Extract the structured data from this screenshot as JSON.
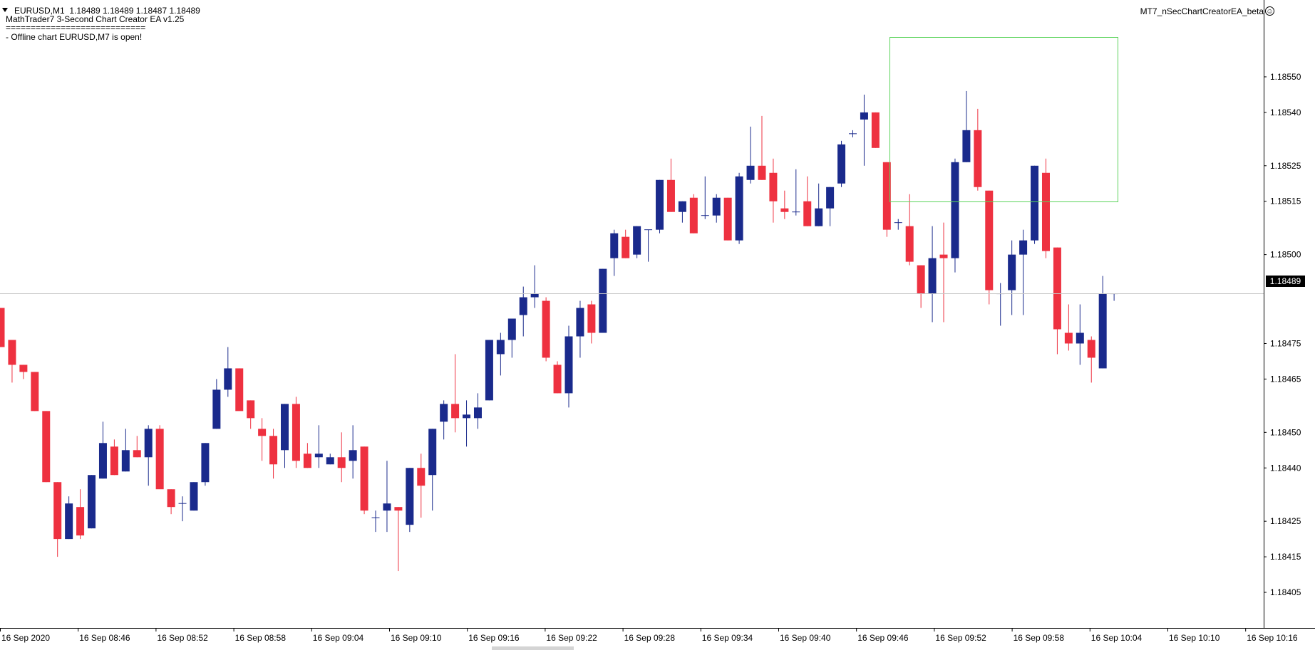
{
  "window": {
    "symbol_line": "EURUSD,M1  1.18489 1.18489 1.18487 1.18489",
    "ea_title_line": "MathTrader7 3-Second Chart Creator EA v1.25",
    "separator_line": "============================",
    "status_line": "- Offline chart EURUSD,M7 is open!",
    "ea_name": "MT7_nSecChartCreatorEA_beta",
    "smiley_icon": "smiley-icon",
    "collapse_icon": "triangle-down-icon"
  },
  "chart_data": {
    "type": "candlestick",
    "symbol": "EURUSD",
    "timeframe": "M1",
    "y_range": [
      1.184,
      1.1856
    ],
    "y_ticks": [
      "1.18550",
      "1.18540",
      "1.18525",
      "1.18515",
      "1.18500",
      "1.18475",
      "1.18465",
      "1.18450",
      "1.18440",
      "1.18425",
      "1.18415",
      "1.18405"
    ],
    "x_ticks": [
      "16 Sep 2020",
      "16 Sep 08:46",
      "16 Sep 08:52",
      "16 Sep 08:58",
      "16 Sep 09:04",
      "16 Sep 09:10",
      "16 Sep 09:16",
      "16 Sep 09:22",
      "16 Sep 09:28",
      "16 Sep 09:34",
      "16 Sep 09:40",
      "16 Sep 09:46",
      "16 Sep 09:52",
      "16 Sep 09:58",
      "16 Sep 10:04",
      "16 Sep 10:10",
      "16 Sep 10:16"
    ],
    "current_price": "1.18489",
    "colors": {
      "bull": "#1a2a8c",
      "bear": "#ee3140",
      "grid_line": "#c8c8c8",
      "selection_box": "#5bd35b"
    },
    "grid": false,
    "candles": [
      {
        "o": 1.18485,
        "h": 1.18485,
        "l": 1.18474,
        "c": 1.18474
      },
      {
        "o": 1.18476,
        "h": 1.18476,
        "l": 1.18464,
        "c": 1.18469
      },
      {
        "o": 1.18469,
        "h": 1.18469,
        "l": 1.18465,
        "c": 1.18467
      },
      {
        "o": 1.18467,
        "h": 1.18467,
        "l": 1.18456,
        "c": 1.18456
      },
      {
        "o": 1.18456,
        "h": 1.18456,
        "l": 1.18436,
        "c": 1.18436
      },
      {
        "o": 1.18436,
        "h": 1.18436,
        "l": 1.18415,
        "c": 1.1842
      },
      {
        "o": 1.1842,
        "h": 1.18432,
        "l": 1.1842,
        "c": 1.1843
      },
      {
        "o": 1.18429,
        "h": 1.18434,
        "l": 1.1842,
        "c": 1.18421
      },
      {
        "o": 1.18423,
        "h": 1.18438,
        "l": 1.18423,
        "c": 1.18438
      },
      {
        "o": 1.18437,
        "h": 1.18453,
        "l": 1.18437,
        "c": 1.18447
      },
      {
        "o": 1.18446,
        "h": 1.18448,
        "l": 1.18438,
        "c": 1.18438
      },
      {
        "o": 1.18439,
        "h": 1.18451,
        "l": 1.18439,
        "c": 1.18445
      },
      {
        "o": 1.18445,
        "h": 1.18449,
        "l": 1.18443,
        "c": 1.18443
      },
      {
        "o": 1.18443,
        "h": 1.18452,
        "l": 1.18435,
        "c": 1.18451
      },
      {
        "o": 1.18451,
        "h": 1.18452,
        "l": 1.18435,
        "c": 1.18434
      },
      {
        "o": 1.18434,
        "h": 1.18434,
        "l": 1.18427,
        "c": 1.18429
      },
      {
        "o": 1.1843,
        "h": 1.18432,
        "l": 1.18425,
        "c": 1.1843
      },
      {
        "o": 1.18428,
        "h": 1.18436,
        "l": 1.18428,
        "c": 1.18436
      },
      {
        "o": 1.18436,
        "h": 1.18447,
        "l": 1.18435,
        "c": 1.18447
      },
      {
        "o": 1.18451,
        "h": 1.18465,
        "l": 1.18451,
        "c": 1.18462
      },
      {
        "o": 1.18462,
        "h": 1.18474,
        "l": 1.1846,
        "c": 1.18468
      },
      {
        "o": 1.18468,
        "h": 1.18468,
        "l": 1.18457,
        "c": 1.18456
      },
      {
        "o": 1.18459,
        "h": 1.18459,
        "l": 1.18451,
        "c": 1.18454
      },
      {
        "o": 1.18451,
        "h": 1.18454,
        "l": 1.18442,
        "c": 1.18449
      },
      {
        "o": 1.18449,
        "h": 1.18451,
        "l": 1.18437,
        "c": 1.18441
      },
      {
        "o": 1.18445,
        "h": 1.18458,
        "l": 1.1844,
        "c": 1.18458
      },
      {
        "o": 1.18458,
        "h": 1.1846,
        "l": 1.1844,
        "c": 1.18442
      },
      {
        "o": 1.18444,
        "h": 1.18447,
        "l": 1.1844,
        "c": 1.1844
      },
      {
        "o": 1.18443,
        "h": 1.18452,
        "l": 1.1844,
        "c": 1.18444
      },
      {
        "o": 1.18441,
        "h": 1.18444,
        "l": 1.18441,
        "c": 1.18443
      },
      {
        "o": 1.18443,
        "h": 1.1845,
        "l": 1.18436,
        "c": 1.1844
      },
      {
        "o": 1.18442,
        "h": 1.18452,
        "l": 1.18437,
        "c": 1.18445
      },
      {
        "o": 1.18446,
        "h": 1.18446,
        "l": 1.18427,
        "c": 1.18428
      },
      {
        "o": 1.18426,
        "h": 1.18428,
        "l": 1.18422,
        "c": 1.18426
      },
      {
        "o": 1.18428,
        "h": 1.18442,
        "l": 1.18422,
        "c": 1.1843
      },
      {
        "o": 1.18429,
        "h": 1.18429,
        "l": 1.18411,
        "c": 1.18428
      },
      {
        "o": 1.18424,
        "h": 1.1844,
        "l": 1.18422,
        "c": 1.1844
      },
      {
        "o": 1.1844,
        "h": 1.18444,
        "l": 1.18426,
        "c": 1.18435
      },
      {
        "o": 1.18438,
        "h": 1.18451,
        "l": 1.18428,
        "c": 1.18451
      },
      {
        "o": 1.18453,
        "h": 1.18459,
        "l": 1.18448,
        "c": 1.18458
      },
      {
        "o": 1.18458,
        "h": 1.18472,
        "l": 1.1845,
        "c": 1.18454
      },
      {
        "o": 1.18454,
        "h": 1.18459,
        "l": 1.18446,
        "c": 1.18455
      },
      {
        "o": 1.18454,
        "h": 1.18461,
        "l": 1.18451,
        "c": 1.18457
      },
      {
        "o": 1.18459,
        "h": 1.18476,
        "l": 1.18459,
        "c": 1.18476
      },
      {
        "o": 1.18472,
        "h": 1.18478,
        "l": 1.18466,
        "c": 1.18476
      },
      {
        "o": 1.18476,
        "h": 1.1848,
        "l": 1.18471,
        "c": 1.18482
      },
      {
        "o": 1.18483,
        "h": 1.18491,
        "l": 1.18477,
        "c": 1.18488
      },
      {
        "o": 1.18488,
        "h": 1.18497,
        "l": 1.18485,
        "c": 1.18489
      },
      {
        "o": 1.18487,
        "h": 1.18488,
        "l": 1.1847,
        "c": 1.18471
      },
      {
        "o": 1.18469,
        "h": 1.1847,
        "l": 1.18461,
        "c": 1.18461
      },
      {
        "o": 1.18461,
        "h": 1.1848,
        "l": 1.18457,
        "c": 1.18477
      },
      {
        "o": 1.18477,
        "h": 1.18487,
        "l": 1.18471,
        "c": 1.18485
      },
      {
        "o": 1.18486,
        "h": 1.18487,
        "l": 1.18475,
        "c": 1.18478
      },
      {
        "o": 1.18478,
        "h": 1.18496,
        "l": 1.18478,
        "c": 1.18496
      },
      {
        "o": 1.18499,
        "h": 1.18507,
        "l": 1.18494,
        "c": 1.18506
      },
      {
        "o": 1.18505,
        "h": 1.18507,
        "l": 1.18499,
        "c": 1.18499
      },
      {
        "o": 1.185,
        "h": 1.18508,
        "l": 1.18499,
        "c": 1.18508
      },
      {
        "o": 1.18507,
        "h": 1.18507,
        "l": 1.18498,
        "c": 1.18507
      },
      {
        "o": 1.18507,
        "h": 1.18521,
        "l": 1.18506,
        "c": 1.18521
      },
      {
        "o": 1.18521,
        "h": 1.18527,
        "l": 1.18512,
        "c": 1.18512
      },
      {
        "o": 1.18512,
        "h": 1.18515,
        "l": 1.18509,
        "c": 1.18515
      },
      {
        "o": 1.18516,
        "h": 1.18517,
        "l": 1.18506,
        "c": 1.18506
      },
      {
        "o": 1.18511,
        "h": 1.18522,
        "l": 1.1851,
        "c": 1.18511
      },
      {
        "o": 1.18511,
        "h": 1.18517,
        "l": 1.18509,
        "c": 1.18516
      },
      {
        "o": 1.18516,
        "h": 1.18516,
        "l": 1.18504,
        "c": 1.18504
      },
      {
        "o": 1.18504,
        "h": 1.18523,
        "l": 1.18503,
        "c": 1.18522
      },
      {
        "o": 1.18521,
        "h": 1.18536,
        "l": 1.1852,
        "c": 1.18525
      },
      {
        "o": 1.18525,
        "h": 1.18539,
        "l": 1.18521,
        "c": 1.18521
      },
      {
        "o": 1.18523,
        "h": 1.18527,
        "l": 1.18509,
        "c": 1.18515
      },
      {
        "o": 1.18513,
        "h": 1.18518,
        "l": 1.1851,
        "c": 1.18512
      },
      {
        "o": 1.18512,
        "h": 1.18524,
        "l": 1.18511,
        "c": 1.18512
      },
      {
        "o": 1.18515,
        "h": 1.18522,
        "l": 1.18508,
        "c": 1.18508
      },
      {
        "o": 1.18508,
        "h": 1.1852,
        "l": 1.18508,
        "c": 1.18513
      },
      {
        "o": 1.18513,
        "h": 1.18519,
        "l": 1.18508,
        "c": 1.18519
      },
      {
        "o": 1.1852,
        "h": 1.18532,
        "l": 1.18519,
        "c": 1.18531
      },
      {
        "o": 1.18534,
        "h": 1.18535,
        "l": 1.18533,
        "c": 1.18534
      },
      {
        "o": 1.18538,
        "h": 1.18545,
        "l": 1.18525,
        "c": 1.1854
      },
      {
        "o": 1.1854,
        "h": 1.1854,
        "l": 1.1853,
        "c": 1.1853
      },
      {
        "o": 1.18526,
        "h": 1.18526,
        "l": 1.18505,
        "c": 1.18507
      },
      {
        "o": 1.18509,
        "h": 1.1851,
        "l": 1.18507,
        "c": 1.18509
      },
      {
        "o": 1.18508,
        "h": 1.18517,
        "l": 1.18497,
        "c": 1.18498
      },
      {
        "o": 1.18497,
        "h": 1.18497,
        "l": 1.18485,
        "c": 1.18489
      },
      {
        "o": 1.18489,
        "h": 1.18508,
        "l": 1.18481,
        "c": 1.18499
      },
      {
        "o": 1.185,
        "h": 1.18509,
        "l": 1.18481,
        "c": 1.18499
      },
      {
        "o": 1.18499,
        "h": 1.18527,
        "l": 1.18495,
        "c": 1.18526
      },
      {
        "o": 1.18526,
        "h": 1.18546,
        "l": 1.18526,
        "c": 1.18535
      },
      {
        "o": 1.18535,
        "h": 1.18541,
        "l": 1.18518,
        "c": 1.18519
      },
      {
        "o": 1.18518,
        "h": 1.18518,
        "l": 1.18486,
        "c": 1.1849
      },
      {
        "o": 1.18489,
        "h": 1.18492,
        "l": 1.1848,
        "c": 1.18489
      },
      {
        "o": 1.1849,
        "h": 1.18504,
        "l": 1.18483,
        "c": 1.185
      },
      {
        "o": 1.185,
        "h": 1.18507,
        "l": 1.18483,
        "c": 1.18504
      },
      {
        "o": 1.18504,
        "h": 1.18525,
        "l": 1.18503,
        "c": 1.18525
      },
      {
        "o": 1.18523,
        "h": 1.18527,
        "l": 1.18499,
        "c": 1.18501
      },
      {
        "o": 1.18502,
        "h": 1.18502,
        "l": 1.18472,
        "c": 1.18479
      },
      {
        "o": 1.18478,
        "h": 1.18486,
        "l": 1.18473,
        "c": 1.18475
      },
      {
        "o": 1.18475,
        "h": 1.18486,
        "l": 1.18469,
        "c": 1.18478
      },
      {
        "o": 1.18476,
        "h": 1.18477,
        "l": 1.18464,
        "c": 1.18471
      },
      {
        "o": 1.18468,
        "h": 1.18494,
        "l": 1.18468,
        "c": 1.18489
      },
      {
        "o": 1.18489,
        "h": 1.18489,
        "l": 1.18487,
        "c": 1.18489
      }
    ],
    "title": "",
    "xlabel": "",
    "ylabel": ""
  }
}
